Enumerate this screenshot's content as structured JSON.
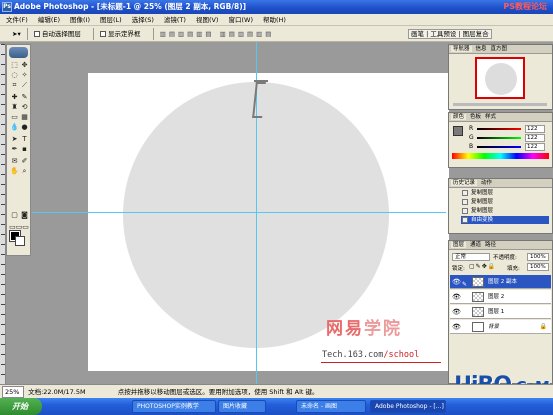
{
  "window": {
    "title": "Adobe Photoshop - [未标题-1 @ 25% (图层 2 副本, RGB/8)]",
    "watermark_top": "PS教程论坛"
  },
  "menu": [
    "文件(F)",
    "编辑(E)",
    "图像(I)",
    "图层(L)",
    "选择(S)",
    "滤镜(T)",
    "视图(V)",
    "窗口(W)",
    "帮助(H)"
  ],
  "options_bar": {
    "auto_select_layer": "自动选择图层",
    "show_bounding_box": "显示定界框"
  },
  "palette_well": [
    "画笔",
    "工具预设",
    "图层复合"
  ],
  "navigator": {
    "tabs": [
      "导航器",
      "信息",
      "直方图"
    ]
  },
  "color_panel": {
    "tabs": [
      "颜色",
      "色板",
      "样式"
    ],
    "channels": [
      {
        "label": "R",
        "value": "122"
      },
      {
        "label": "G",
        "value": "122"
      },
      {
        "label": "B",
        "value": "122"
      }
    ]
  },
  "history_panel": {
    "tabs": [
      "历史记录",
      "动作"
    ],
    "items": [
      "复制图层",
      "复制图层",
      "复制图层",
      "自由变换"
    ],
    "selected_index": 3
  },
  "layers_panel": {
    "tabs": [
      "图层",
      "通道",
      "路径"
    ],
    "blend_mode": "正常",
    "opacity_label": "不透明度:",
    "opacity_value": "100%",
    "lock_label": "锁定:",
    "fill_label": "填充:",
    "fill_value": "100%",
    "layers": [
      {
        "name": "图层 2 副本",
        "selected": true
      },
      {
        "name": "图层 2",
        "selected": false
      },
      {
        "name": "图层 1",
        "selected": false
      },
      {
        "name": "背景",
        "selected": false
      }
    ]
  },
  "canvas": {
    "bg_color": "#ffffff",
    "circle_color": "#e0e0e0",
    "guide_color": "#56c8f0"
  },
  "watermark": {
    "logo_wang": "网易",
    "logo_xue": "学院",
    "url_tech": "Tech.163.com",
    "url_path": "/school",
    "uibq": "UiBQ",
    "uibq_com": ".CoM"
  },
  "statusbar": {
    "zoom": "25%",
    "doc": "文档:22.0M/17.5M",
    "hint": "点按并拖移以移动图层或选区。要用附加选项，使用 Shift 和 Alt 键。"
  },
  "taskbar": {
    "start": "开始",
    "tasks": [
      "PHOTOSHOP实例教学",
      "图片收藏",
      "未命名 - 画图",
      "Adobe Photoshop - [...]"
    ]
  }
}
